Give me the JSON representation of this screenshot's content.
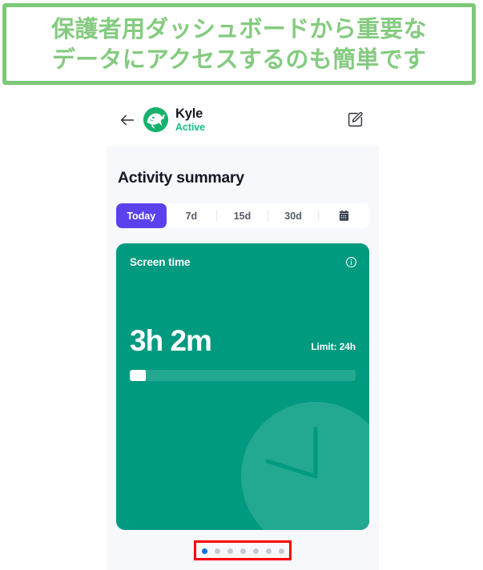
{
  "caption": {
    "line1": "保護者用ダッシュボードから重要な",
    "line2": "データにアクセスするのも簡単です",
    "border_color": "#7dc878",
    "text_color": "#84cb7f"
  },
  "app": {
    "header": {
      "back_icon": "back-arrow-icon",
      "avatar_icon": "whale-avatar-icon",
      "child_name": "Kyle",
      "status": "Active",
      "status_color": "#1dbd86",
      "edit_icon": "edit-pencil-icon"
    },
    "section_title": "Activity summary",
    "tabs": [
      {
        "label": "Today",
        "active": true
      },
      {
        "label": "7d",
        "active": false
      },
      {
        "label": "15d",
        "active": false
      },
      {
        "label": "30d",
        "active": false
      }
    ],
    "calendar_tab": {
      "icon": "calendar-icon"
    },
    "active_tab_color": "#5a41ec",
    "card": {
      "title": "Screen time",
      "info_icon": "info-circle-icon",
      "value": "3h 2m",
      "limit": "Limit: 24h",
      "progress_percent": 7,
      "background_color": "#009a80",
      "track_color": "#23a891",
      "clock_icon": "clock-watermark-icon"
    },
    "pager": {
      "total_dots": 7,
      "active_index": 0,
      "active_color": "#0a73e8",
      "inactive_color": "#c6c9d3",
      "highlight_color": "#fb0103"
    }
  }
}
